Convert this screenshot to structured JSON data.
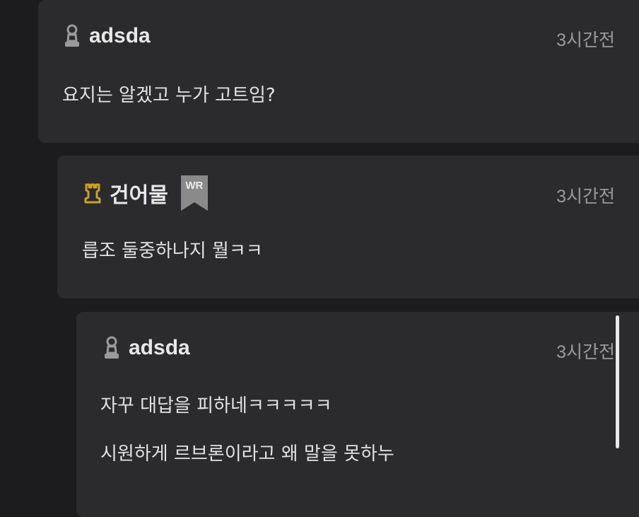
{
  "comments": [
    {
      "author": "adsda",
      "rank_icon": "pawn-icon",
      "time": "3시간전",
      "lines": [
        "요지는 알겠고 누가 고트임?"
      ]
    },
    {
      "author": "건어물",
      "rank_icon": "rook-icon",
      "badge": "WR",
      "time": "3시간전",
      "lines": [
        "릅조 둘중하나지 뭘ㅋㅋ"
      ]
    },
    {
      "author": "adsda",
      "rank_icon": "pawn-icon",
      "time": "3시간전",
      "lines": [
        "자꾸 대답을 피하네ㅋㅋㅋㅋㅋ",
        "시원하게 르브론이라고 왜 말을 못하누"
      ]
    }
  ],
  "colors": {
    "background": "#1c1c1e",
    "card": "#2b2b2d",
    "rook_gold": "#c9a227",
    "pawn_gray": "#9a9a9a",
    "badge_gray": "#8a8a8a"
  }
}
